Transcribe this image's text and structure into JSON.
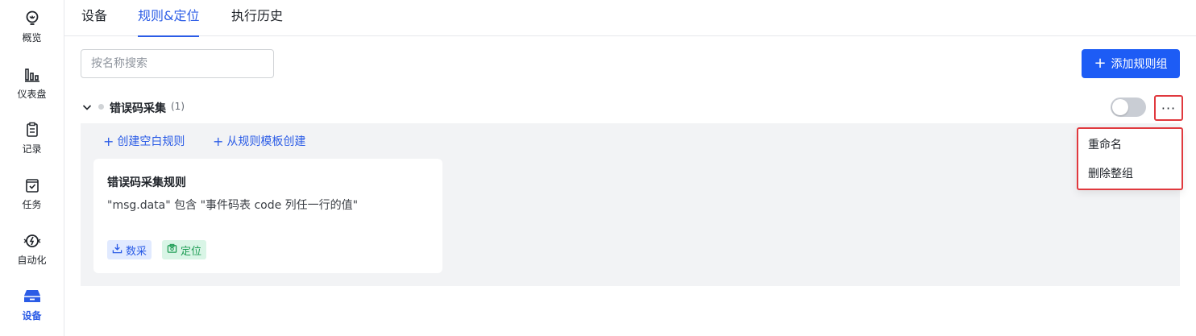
{
  "sidebar": {
    "items": [
      {
        "label": "概览",
        "icon": "lightbulb-icon"
      },
      {
        "label": "仪表盘",
        "icon": "bar-chart-icon"
      },
      {
        "label": "记录",
        "icon": "clipboard-icon"
      },
      {
        "label": "任务",
        "icon": "task-check-icon"
      },
      {
        "label": "自动化",
        "icon": "automation-icon"
      },
      {
        "label": "设备",
        "icon": "device-box-icon",
        "active": true
      }
    ]
  },
  "tabs": [
    {
      "label": "设备"
    },
    {
      "label": "规则&定位",
      "active": true
    },
    {
      "label": "执行历史"
    }
  ],
  "search": {
    "placeholder": "按名称搜索",
    "value": ""
  },
  "toolbar": {
    "add_group_label": "添加规则组"
  },
  "group": {
    "name": "错误码采集",
    "count": "(1)",
    "enabled": false,
    "more_label": "···",
    "actions": {
      "create_blank": "创建空白规则",
      "create_from_template": "从规则模板创建"
    },
    "rules": [
      {
        "title": "错误码采集规则",
        "description": "\"msg.data\" 包含 \"事件码表 code 列任一行的值\"",
        "tags": [
          {
            "label": "数采",
            "icon": "download-tray-icon",
            "color": "#2b5ce6"
          },
          {
            "label": "定位",
            "icon": "locate-icon",
            "color": "#1f9d55"
          }
        ]
      }
    ]
  },
  "menu": {
    "items": [
      {
        "label": "重命名"
      },
      {
        "label": "删除整组"
      }
    ]
  },
  "colors": {
    "accent": "#1d5cf5",
    "highlight": "#e0393e",
    "group_bg": "#f2f3f5"
  }
}
